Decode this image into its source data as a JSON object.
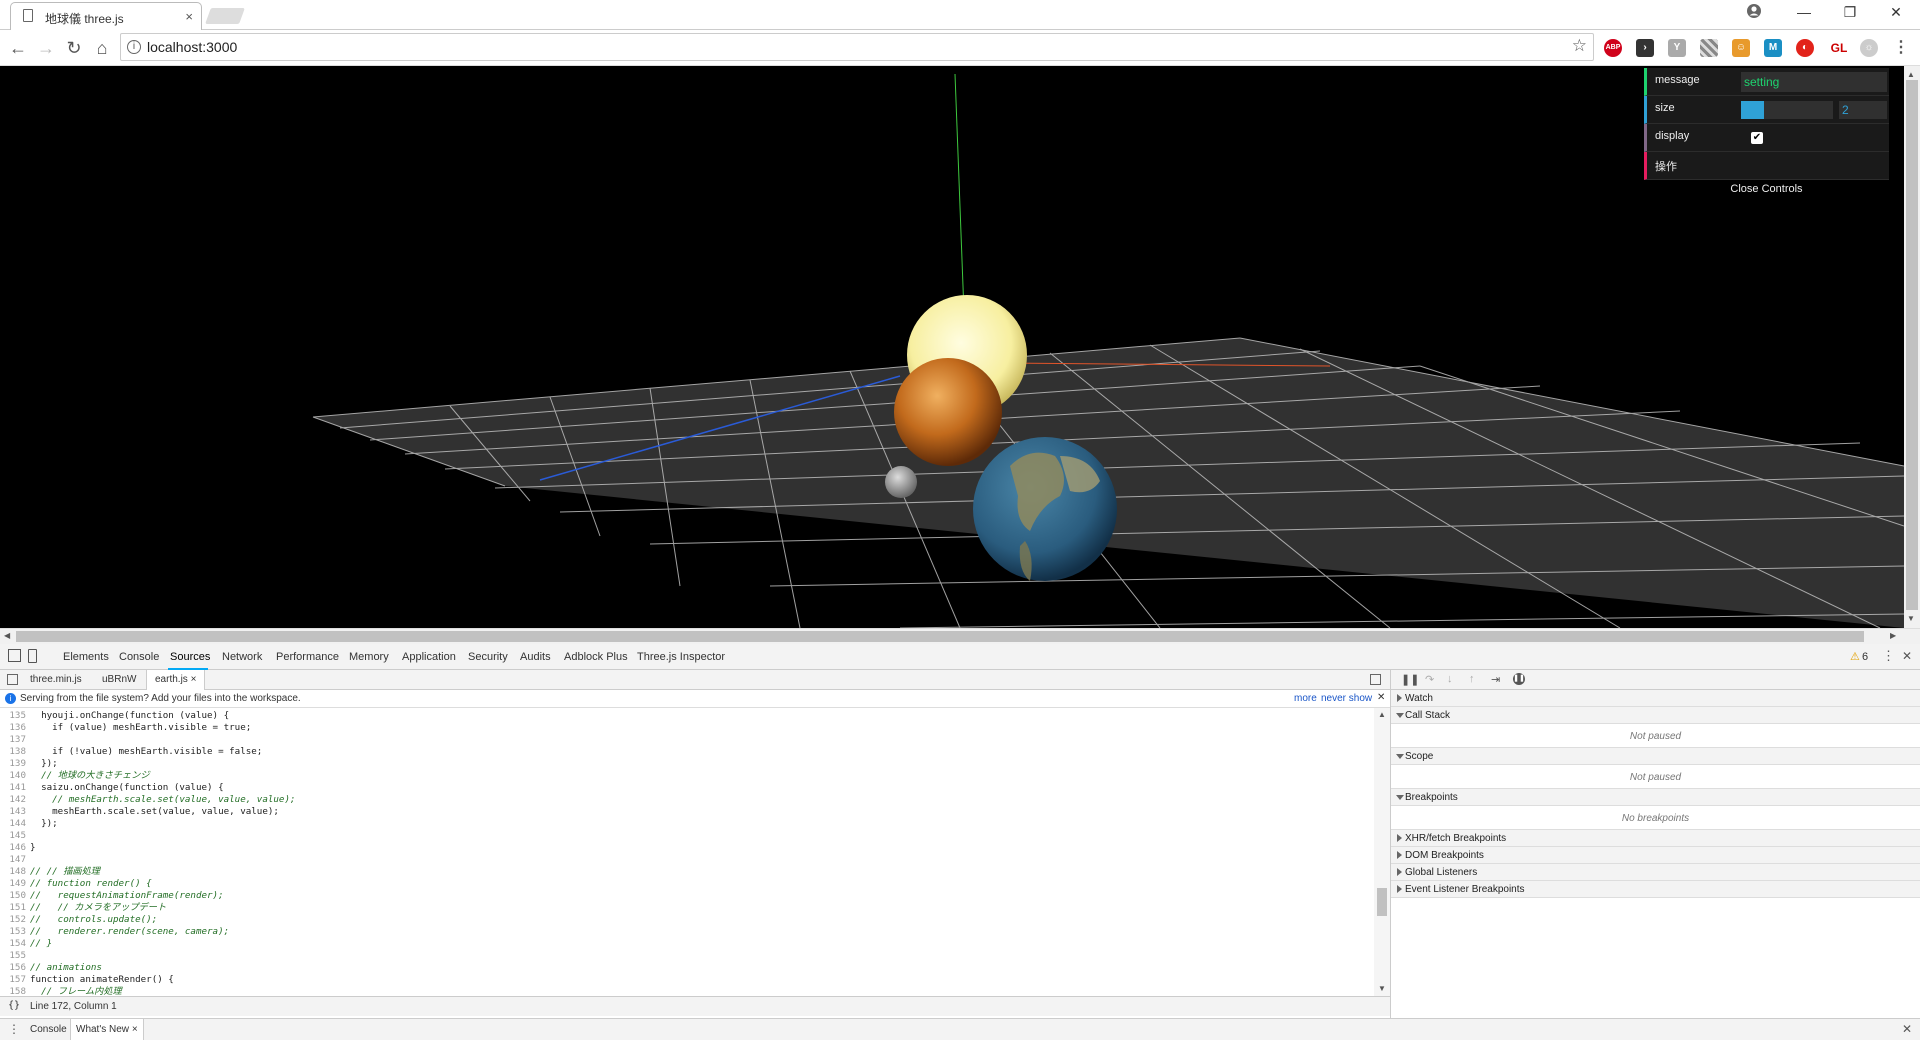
{
  "browser": {
    "tab_title": "地球儀 three.js",
    "tab_close": "×",
    "url": "localhost:3000",
    "extensions": [
      "ABP",
      "GL"
    ]
  },
  "gui": {
    "message_label": "message",
    "message_value": "setting",
    "size_label": "size",
    "size_value": "2",
    "size_fraction": 0.25,
    "display_label": "display",
    "display_checked": true,
    "operation_label": "操作",
    "close_label": "Close Controls",
    "accent_colors": {
      "message": "#1ed36f",
      "size": "#2fa1d6",
      "display": "#806787",
      "operation": "#e61d5f"
    }
  },
  "devtools": {
    "tabs": [
      "Elements",
      "Console",
      "Sources",
      "Network",
      "Performance",
      "Memory",
      "Application",
      "Security",
      "Audits",
      "Adblock Plus",
      "Three.js Inspector"
    ],
    "active_tab": "Sources",
    "warning_count": "6",
    "file_tabs": [
      "three.min.js",
      "uBRnW",
      "earth.js"
    ],
    "active_file": "earth.js",
    "info_message": "Serving from the file system? Add your files into the workspace.",
    "info_more": "more",
    "info_never_show": "never show",
    "status": "Line 172, Column 1",
    "drawer_tabs": [
      "Console",
      "What's New"
    ],
    "code_lines": [
      {
        "n": "135",
        "t": "  hyouji.onChange(function (value) {"
      },
      {
        "n": "136",
        "t": "    if (value) meshEarth.visible = true;"
      },
      {
        "n": "137",
        "t": ""
      },
      {
        "n": "138",
        "t": "    if (!value) meshEarth.visible = false;"
      },
      {
        "n": "139",
        "t": "  });"
      },
      {
        "n": "140",
        "t": "  // 地球の大きさチェンジ"
      },
      {
        "n": "141",
        "t": "  saizu.onChange(function (value) {"
      },
      {
        "n": "142",
        "t": "    // meshEarth.scale.set(value, value, value);"
      },
      {
        "n": "143",
        "t": "    meshEarth.scale.set(value, value, value);"
      },
      {
        "n": "144",
        "t": "  });"
      },
      {
        "n": "145",
        "t": ""
      },
      {
        "n": "146",
        "t": "}"
      },
      {
        "n": "147",
        "t": ""
      },
      {
        "n": "148",
        "t": "// // 描画処理"
      },
      {
        "n": "149",
        "t": "// function render() {"
      },
      {
        "n": "150",
        "t": "//   requestAnimationFrame(render);"
      },
      {
        "n": "151",
        "t": "//   // カメラをアップデート"
      },
      {
        "n": "152",
        "t": "//   controls.update();"
      },
      {
        "n": "153",
        "t": "//   renderer.render(scene, camera);"
      },
      {
        "n": "154",
        "t": "// }"
      },
      {
        "n": "155",
        "t": ""
      },
      {
        "n": "156",
        "t": "// animations"
      },
      {
        "n": "157",
        "t": "function animateRender() {"
      },
      {
        "n": "158",
        "t": "  // フレーム内処理"
      }
    ],
    "sidebar": {
      "watch": "Watch",
      "call_stack": "Call Stack",
      "call_stack_empty": "Not paused",
      "scope": "Scope",
      "scope_empty": "Not paused",
      "breakpoints": "Breakpoints",
      "breakpoints_empty": "No breakpoints",
      "xhr": "XHR/fetch Breakpoints",
      "dom": "DOM Breakpoints",
      "global": "Global Listeners",
      "event": "Event Listener Breakpoints"
    }
  }
}
